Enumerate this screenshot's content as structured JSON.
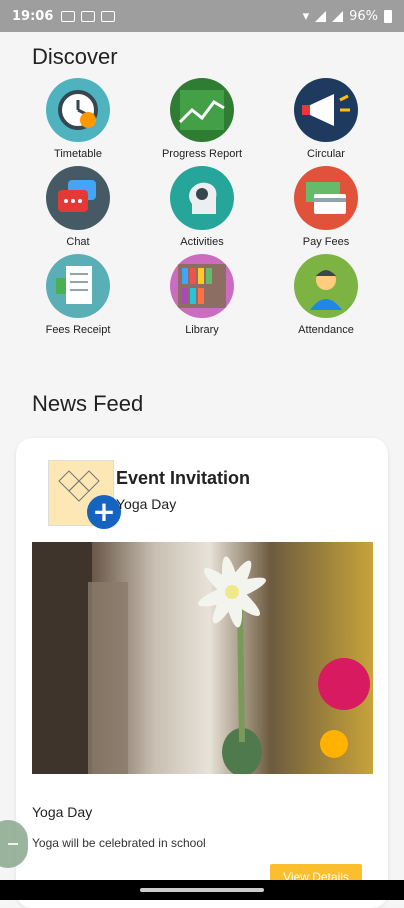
{
  "status_bar": {
    "time": "19:06",
    "battery": "96%"
  },
  "discover": {
    "title": "Discover",
    "items": [
      {
        "label": "Timetable",
        "icon": "clock-icon",
        "color": "#4fb3bf"
      },
      {
        "label": "Progress Report",
        "icon": "chart-line-icon",
        "color": "#2e7d32"
      },
      {
        "label": "Circular",
        "icon": "megaphone-icon",
        "color": "#1f3a5f"
      },
      {
        "label": "Chat",
        "icon": "chat-bubbles-icon",
        "color": "#455a64"
      },
      {
        "label": "Activities",
        "icon": "head-gears-icon",
        "color": "#26a69a"
      },
      {
        "label": "Pay Fees",
        "icon": "payment-card-icon",
        "color": "#e0533a"
      },
      {
        "label": "Fees Receipt",
        "icon": "receipt-icon",
        "color": "#5aaeb6"
      },
      {
        "label": "Library",
        "icon": "bookshelf-icon",
        "color": "#cc6cc0"
      },
      {
        "label": "Attendance",
        "icon": "student-icon",
        "color": "#7cb342"
      }
    ]
  },
  "news_feed": {
    "title": "News Feed",
    "card": {
      "title": "Event Invitation",
      "subtitle": "Yoga Day",
      "heading": "Yoga Day",
      "description": "Yoga will be celebrated in school",
      "button": "View Details"
    }
  }
}
